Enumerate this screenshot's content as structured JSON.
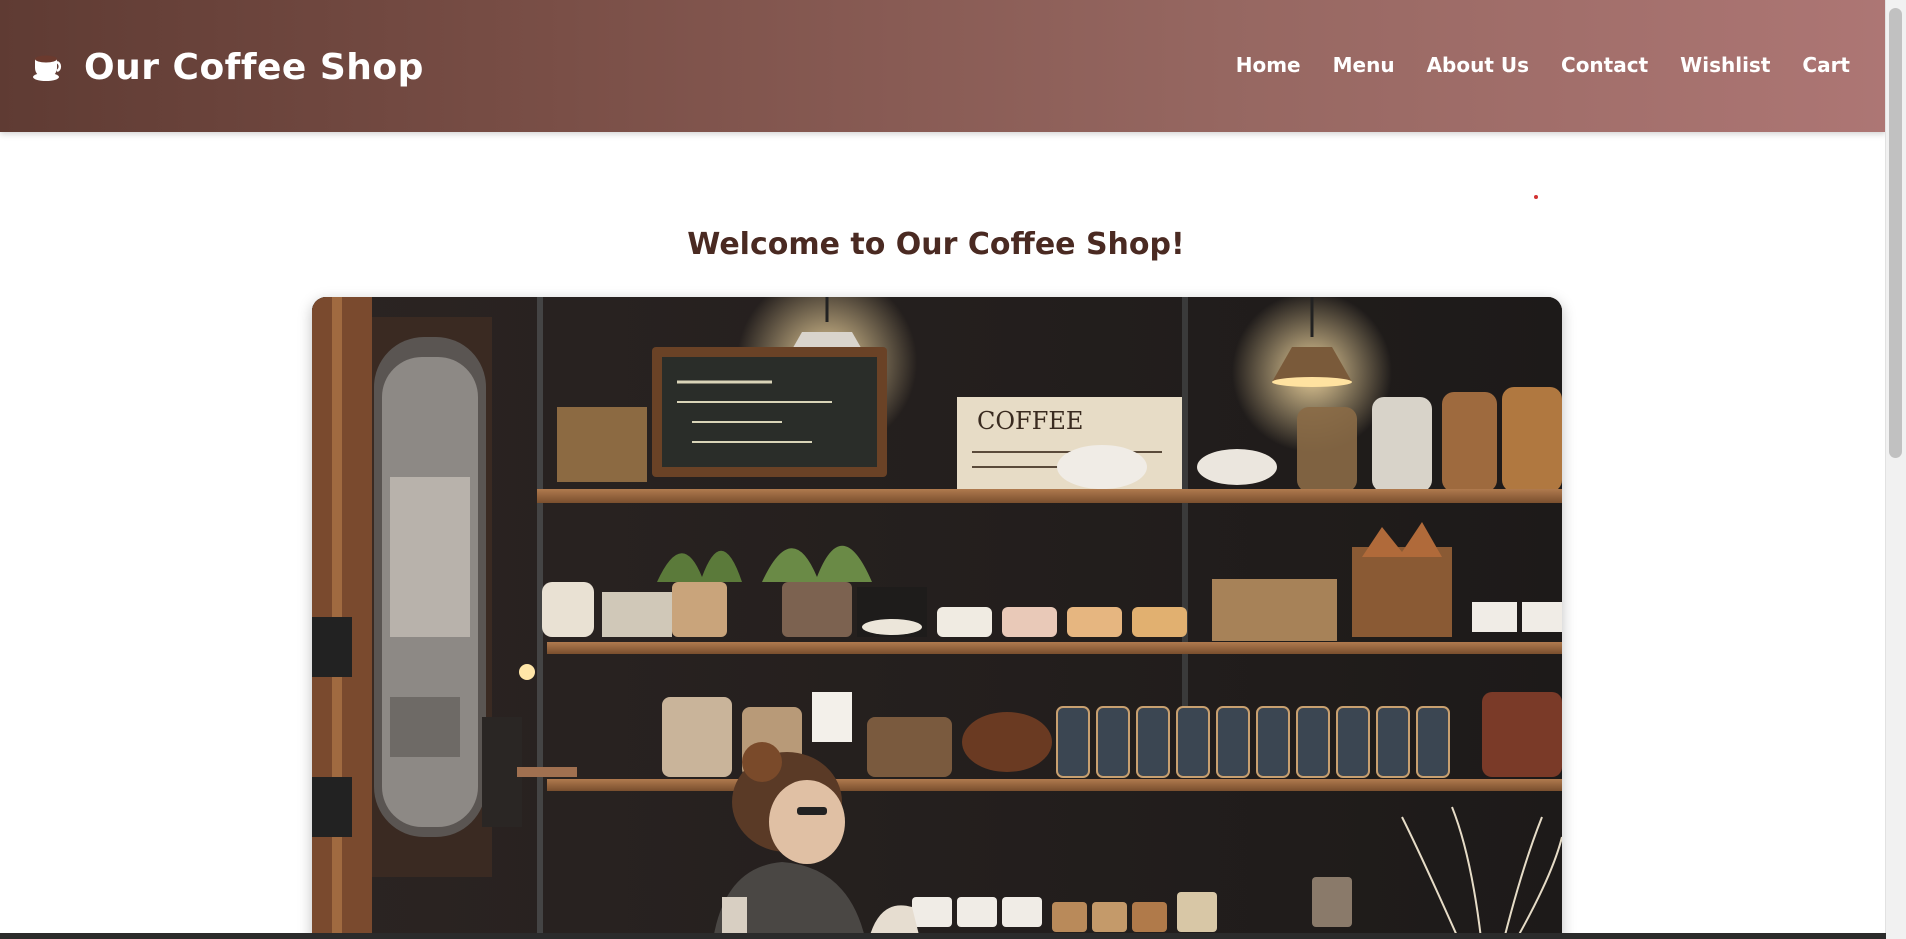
{
  "header": {
    "brand_title": "Our Coffee Shop",
    "brand_icon": "coffee-cup-icon",
    "nav": [
      {
        "label": "Home"
      },
      {
        "label": "Menu"
      },
      {
        "label": "About Us"
      },
      {
        "label": "Contact"
      },
      {
        "label": "Wishlist"
      },
      {
        "label": "Cart"
      }
    ]
  },
  "main": {
    "welcome_title": "Welcome to Our Coffee Shop!",
    "hero_image": {
      "sign_text": "COFFEE"
    }
  },
  "colors": {
    "header_start": "#5f3b33",
    "header_end": "#ad7674",
    "title_color": "#4a2a22",
    "nav_text": "#ffffff"
  }
}
